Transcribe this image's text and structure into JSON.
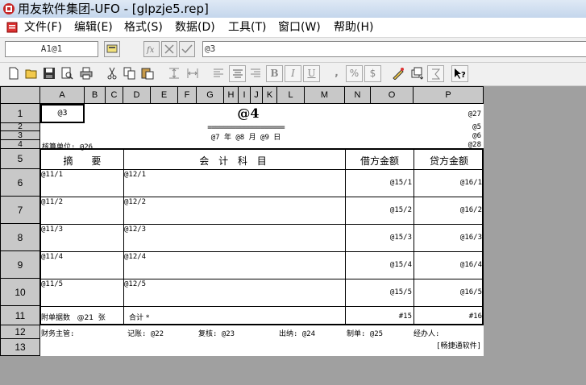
{
  "window": {
    "title": "用友软件集团-UFO - [glpzje5.rep]"
  },
  "menu": [
    {
      "label": "文件(F)"
    },
    {
      "label": "编辑(E)"
    },
    {
      "label": "格式(S)"
    },
    {
      "label": "数据(D)"
    },
    {
      "label": "工具(T)"
    },
    {
      "label": "窗口(W)"
    },
    {
      "label": "帮助(H)"
    }
  ],
  "formula_bar": {
    "cell_ref": "A1@1",
    "formula": "@3"
  },
  "toolbar": {
    "icons": [
      "new-icon",
      "open-icon",
      "save-icon",
      "print-preview-icon",
      "print-icon",
      "cut-icon",
      "copy-icon",
      "paste-icon",
      "row-height-icon",
      "col-width-icon",
      "align-left-icon",
      "align-center-icon",
      "align-right-icon",
      "bold-icon",
      "italic-icon",
      "underline-icon",
      "comma-icon",
      "percent-icon",
      "currency-icon",
      "draw-icon",
      "sort-icon",
      "sum-icon",
      "help-icon"
    ],
    "labels": {
      "bold": "B",
      "italic": "I",
      "underline": "U",
      "comma": ",",
      "percent": "%",
      "currency": "$"
    }
  },
  "columns": [
    "A",
    "B",
    "C",
    "D",
    "E",
    "F",
    "G",
    "H",
    "I",
    "J",
    "K",
    "L",
    "M",
    "N",
    "O",
    "P"
  ],
  "rows": [
    "1",
    "2",
    "3",
    "4",
    "5",
    "6",
    "7",
    "8",
    "9",
    "10",
    "11",
    "12",
    "13"
  ],
  "sheet": {
    "a1": "@3",
    "title": "@4",
    "r1_right": "@27",
    "double_rule": "===================",
    "r2_right": "@5",
    "date_line": "@7 年 @8 月 @9 日",
    "r3_right": "@6",
    "unit": "核算单位: @26",
    "r4_right": "@28",
    "header": {
      "summary": "摘      要",
      "account": "会 计 科 目",
      "debit": "借方金额",
      "credit": "贷方金额"
    },
    "body_rows": [
      {
        "summary": "@11/1",
        "account": "@12/1",
        "debit": "@15/1",
        "credit": "@16/1"
      },
      {
        "summary": "@11/2",
        "account": "@12/2",
        "debit": "@15/2",
        "credit": "@16/2"
      },
      {
        "summary": "@11/3",
        "account": "@12/3",
        "debit": "@15/3",
        "credit": "@16/3"
      },
      {
        "summary": "@11/4",
        "account": "@12/4",
        "debit": "@15/4",
        "credit": "@16/4"
      },
      {
        "summary": "@11/5",
        "account": "@12/5",
        "debit": "@15/5",
        "credit": "@16/5"
      }
    ],
    "footer": {
      "attach": "附单据数   @21  张",
      "total": "合计 *",
      "debit_total": "#15",
      "credit_total": "#16"
    },
    "signoff": {
      "supervisor": "财务主管:",
      "bookkeeper": "记账: @22",
      "reviewer": "复核: @23",
      "cashier": "出纳: @24",
      "preparer": "制单: @25",
      "handler": "经办人:"
    },
    "brand": "[畅捷通软件]"
  }
}
